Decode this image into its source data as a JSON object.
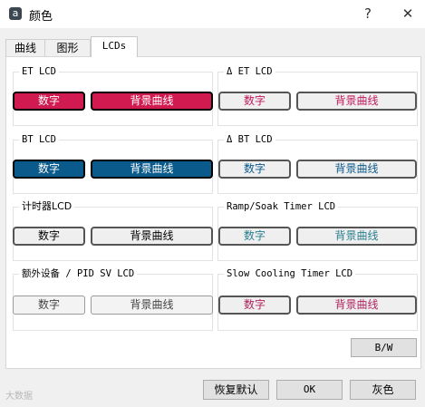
{
  "window": {
    "title": "颜色",
    "help_icon": "?",
    "close_icon": "✕"
  },
  "tabs": [
    {
      "label": "曲线"
    },
    {
      "label": "图形"
    },
    {
      "label": "LCDs"
    }
  ],
  "groups": {
    "et": {
      "title": "ET LCD",
      "digits": "数字",
      "background": "背景曲线",
      "digits_fg": "#ffffff",
      "digits_bg": "#d11a4f"
    },
    "delta_et": {
      "title": "Δ ET LCD",
      "digits": "数字",
      "background": "背景曲线",
      "fg": "#c2185b"
    },
    "bt": {
      "title": "BT LCD",
      "digits": "数字",
      "background": "背景曲线",
      "digits_fg": "#ffffff",
      "digits_bg": "#0b5a8c"
    },
    "delta_bt": {
      "title": "Δ BT LCD",
      "digits": "数字",
      "background": "背景曲线",
      "fg": "#0b5a8c"
    },
    "timer": {
      "title": "计时器LCD",
      "digits": "数字",
      "background": "背景曲线"
    },
    "ramp": {
      "title": "Ramp/Soak Timer LCD",
      "digits": "数字",
      "background": "背景曲线",
      "fg": "#2a7f8f"
    },
    "extra": {
      "title": "额外设备 / PID SV LCD",
      "digits": "数字",
      "background": "背景曲线"
    },
    "cooling": {
      "title": "Slow Cooling Timer LCD",
      "digits": "数字",
      "background": "背景曲线",
      "fg": "#b0245e"
    }
  },
  "buttons": {
    "bw": "B/W",
    "restore_defaults": "恢复默认",
    "ok": "OK",
    "grey": "灰色"
  },
  "watermark": "大数据"
}
